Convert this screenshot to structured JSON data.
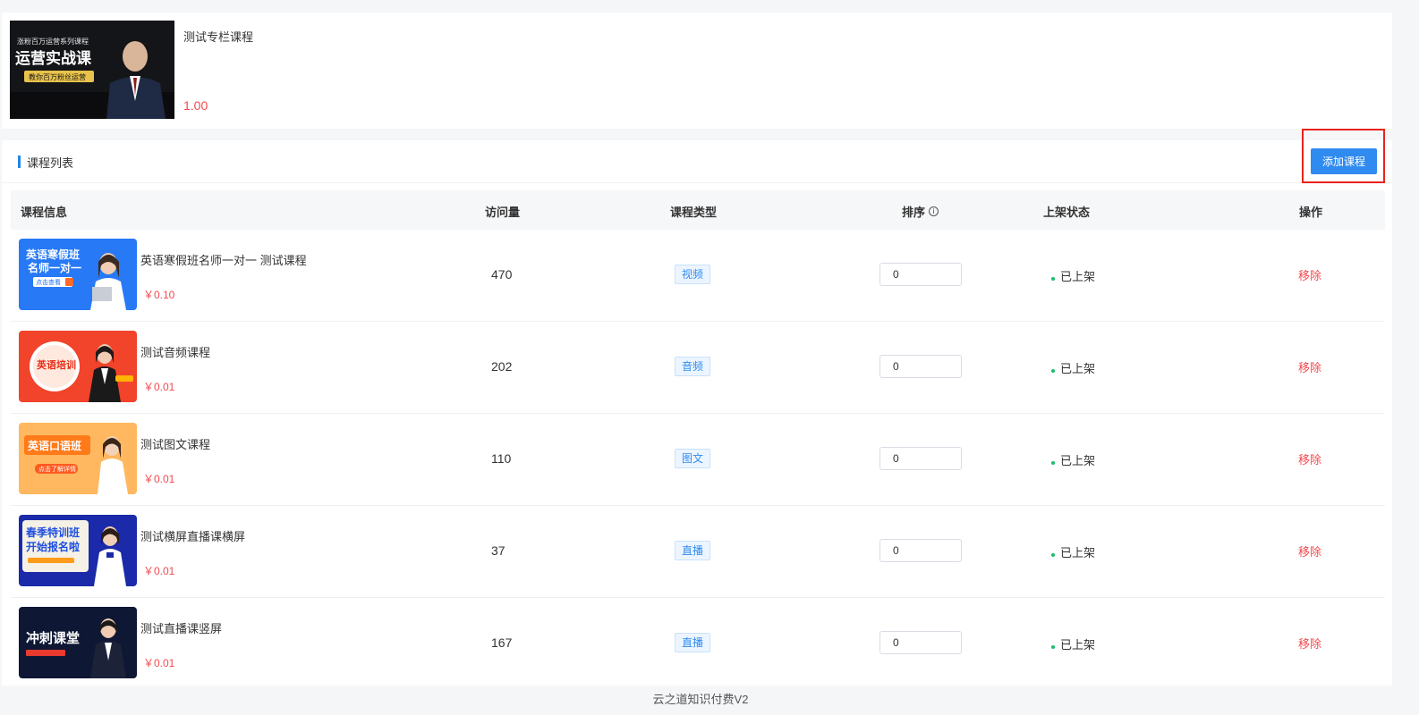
{
  "top": {
    "title": "测试专栏课程",
    "price": "1.00",
    "thumb_text": {
      "line1": "涨粉百万运营系列课程",
      "big": "运营实战课",
      "pill": "教你百万粉丝运营"
    }
  },
  "list": {
    "title": "课程列表",
    "add_button": "添加课程",
    "columns": {
      "info": "课程信息",
      "visits": "访问量",
      "type": "课程类型",
      "sort": "排序",
      "status": "上架状态",
      "ops": "操作"
    },
    "rows": [
      {
        "name": "英语寒假班名师一对一 测试课程",
        "price": "￥0.10",
        "visits": "470",
        "type": "视频",
        "sort": "0",
        "status": "已上架",
        "action": "移除",
        "thumb": {
          "big1": "英语寒假班",
          "big2": "名师一对一",
          "btn": "点击查看"
        }
      },
      {
        "name": "测试音频课程",
        "price": "￥0.01",
        "visits": "202",
        "type": "音频",
        "sort": "0",
        "status": "已上架",
        "action": "移除",
        "thumb": {
          "big1": "英语培训"
        }
      },
      {
        "name": "测试图文课程",
        "price": "￥0.01",
        "visits": "110",
        "type": "图文",
        "sort": "0",
        "status": "已上架",
        "action": "移除",
        "thumb": {
          "big1": "英语口语班",
          "btn": "点击了解详情"
        }
      },
      {
        "name": "测试横屏直播课横屏",
        "price": "￥0.01",
        "visits": "37",
        "type": "直播",
        "sort": "0",
        "status": "已上架",
        "action": "移除",
        "thumb": {
          "big1": "春季特训班",
          "big2": "开始报名啦"
        }
      },
      {
        "name": "测试直播课竖屏",
        "price": "￥0.01",
        "visits": "167",
        "type": "直播",
        "sort": "0",
        "status": "已上架",
        "action": "移除",
        "thumb": {
          "big1": "冲刺课堂"
        }
      }
    ]
  },
  "footer": "云之道知识付费V2",
  "colors": {
    "primary": "#2f8bf0",
    "danger": "#f5494f",
    "success": "#19be6b",
    "highlight": "#e8231d"
  }
}
